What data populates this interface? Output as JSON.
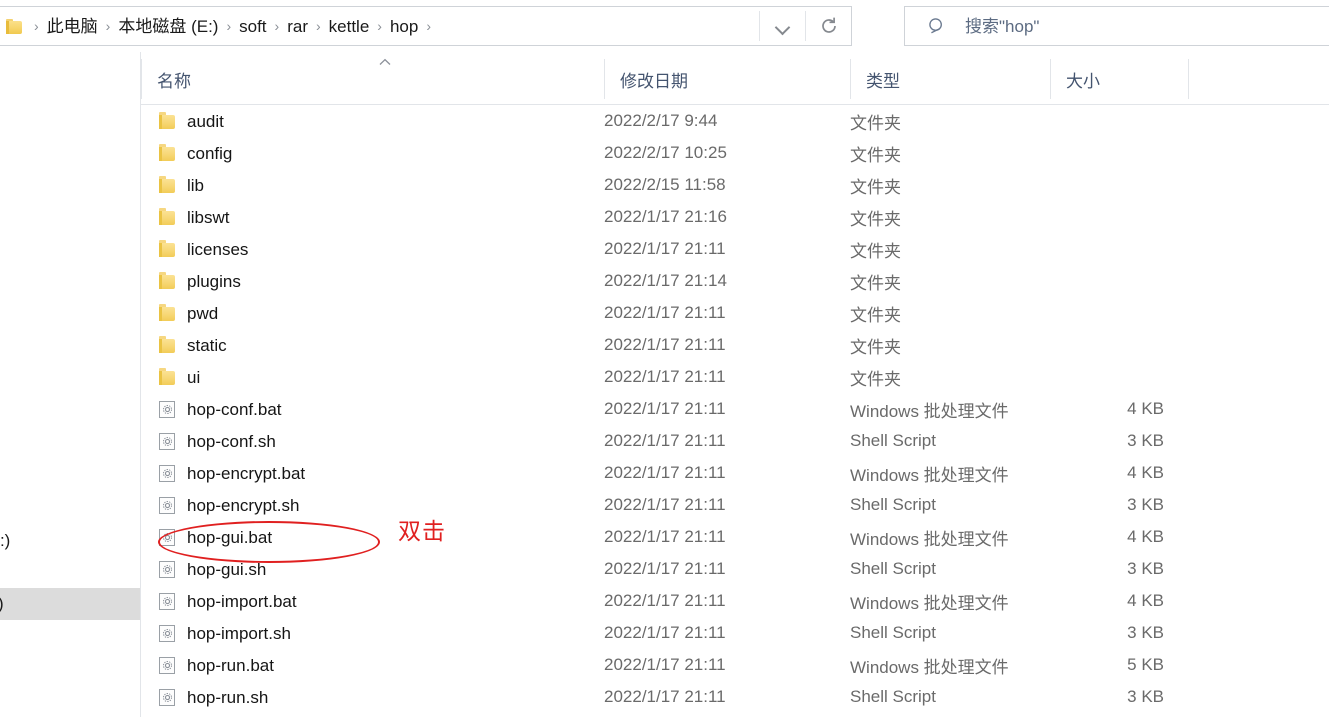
{
  "address_bar": {
    "folder_icon": "folder-icon",
    "breadcrumbs": [
      {
        "label": "此电脑"
      },
      {
        "label": "本地磁盘 (E:)"
      },
      {
        "label": "soft"
      },
      {
        "label": "rar"
      },
      {
        "label": "kettle"
      },
      {
        "label": "hop"
      }
    ],
    "separator": "›",
    "dropdown_icon": "chevron-down-icon",
    "refresh_icon": "refresh-icon"
  },
  "search": {
    "icon": "search-icon",
    "placeholder": "搜索\"hop\""
  },
  "left_nav": {
    "items": [
      {
        "label": "(C:)",
        "selected": false
      },
      {
        "label": "E:)",
        "selected": true
      }
    ]
  },
  "columns": {
    "name": "名称",
    "date_modified": "修改日期",
    "type": "类型",
    "size": "大小",
    "sort_indicator": "sort-ascending-icon"
  },
  "files": [
    {
      "icon": "folder-icon",
      "name": "audit",
      "date": "2022/2/17 9:44",
      "type": "文件夹",
      "size": ""
    },
    {
      "icon": "folder-icon",
      "name": "config",
      "date": "2022/2/17 10:25",
      "type": "文件夹",
      "size": ""
    },
    {
      "icon": "folder-icon",
      "name": "lib",
      "date": "2022/2/15 11:58",
      "type": "文件夹",
      "size": ""
    },
    {
      "icon": "folder-icon",
      "name": "libswt",
      "date": "2022/1/17 21:16",
      "type": "文件夹",
      "size": ""
    },
    {
      "icon": "folder-icon",
      "name": "licenses",
      "date": "2022/1/17 21:11",
      "type": "文件夹",
      "size": ""
    },
    {
      "icon": "folder-icon",
      "name": "plugins",
      "date": "2022/1/17 21:14",
      "type": "文件夹",
      "size": ""
    },
    {
      "icon": "folder-icon",
      "name": "pwd",
      "date": "2022/1/17 21:11",
      "type": "文件夹",
      "size": ""
    },
    {
      "icon": "folder-icon",
      "name": "static",
      "date": "2022/1/17 21:11",
      "type": "文件夹",
      "size": ""
    },
    {
      "icon": "folder-icon",
      "name": "ui",
      "date": "2022/1/17 21:11",
      "type": "文件夹",
      "size": ""
    },
    {
      "icon": "script-icon",
      "name": "hop-conf.bat",
      "date": "2022/1/17 21:11",
      "type": "Windows 批处理文件",
      "size": "4 KB"
    },
    {
      "icon": "script-icon",
      "name": "hop-conf.sh",
      "date": "2022/1/17 21:11",
      "type": "Shell Script",
      "size": "3 KB"
    },
    {
      "icon": "script-icon",
      "name": "hop-encrypt.bat",
      "date": "2022/1/17 21:11",
      "type": "Windows 批处理文件",
      "size": "4 KB"
    },
    {
      "icon": "script-icon",
      "name": "hop-encrypt.sh",
      "date": "2022/1/17 21:11",
      "type": "Shell Script",
      "size": "3 KB"
    },
    {
      "icon": "script-icon",
      "name": "hop-gui.bat",
      "date": "2022/1/17 21:11",
      "type": "Windows 批处理文件",
      "size": "4 KB"
    },
    {
      "icon": "script-icon",
      "name": "hop-gui.sh",
      "date": "2022/1/17 21:11",
      "type": "Shell Script",
      "size": "3 KB"
    },
    {
      "icon": "script-icon",
      "name": "hop-import.bat",
      "date": "2022/1/17 21:11",
      "type": "Windows 批处理文件",
      "size": "4 KB"
    },
    {
      "icon": "script-icon",
      "name": "hop-import.sh",
      "date": "2022/1/17 21:11",
      "type": "Shell Script",
      "size": "3 KB"
    },
    {
      "icon": "script-icon",
      "name": "hop-run.bat",
      "date": "2022/1/17 21:11",
      "type": "Windows 批处理文件",
      "size": "5 KB"
    },
    {
      "icon": "script-icon",
      "name": "hop-run.sh",
      "date": "2022/1/17 21:11",
      "type": "Shell Script",
      "size": "3 KB"
    }
  ],
  "annotation": {
    "label": "双击",
    "color": "#e02020",
    "target": "hop-gui.bat"
  }
}
